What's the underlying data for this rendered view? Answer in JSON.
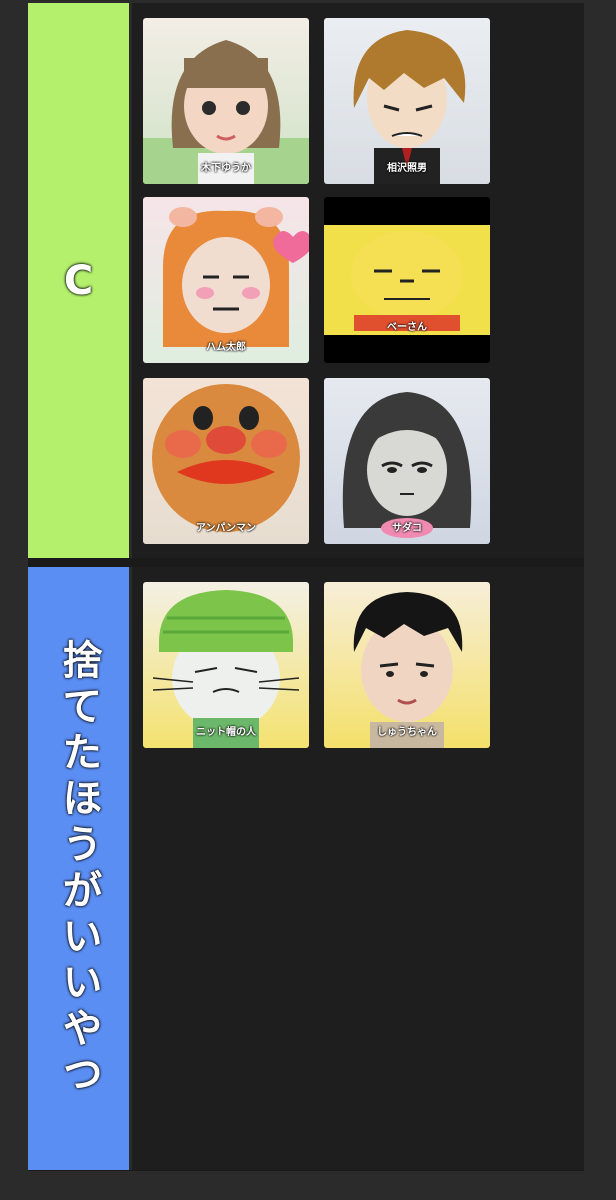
{
  "tiers": [
    {
      "label": "C",
      "color": "#b4f06c",
      "cards": [
        {
          "caption": "木下ゆうか",
          "face": "girl-bangs"
        },
        {
          "caption": "相沢照男",
          "face": "brown-hair-man"
        },
        {
          "caption": "ハム太郎",
          "face": "hamster-hood"
        },
        {
          "caption": "ベーさん",
          "face": "yellow-blob"
        },
        {
          "caption": "アンパンマン",
          "face": "orange-face"
        },
        {
          "caption": "サダコ",
          "face": "ghost-girl"
        }
      ]
    },
    {
      "label": "捨てたほうがいいやつ",
      "color": "#5b8ef3",
      "cards": [
        {
          "caption": "ニット帽の人",
          "face": "knit-cap-cat"
        },
        {
          "caption": "しゅうちゃん",
          "face": "black-hair-man"
        }
      ]
    }
  ]
}
